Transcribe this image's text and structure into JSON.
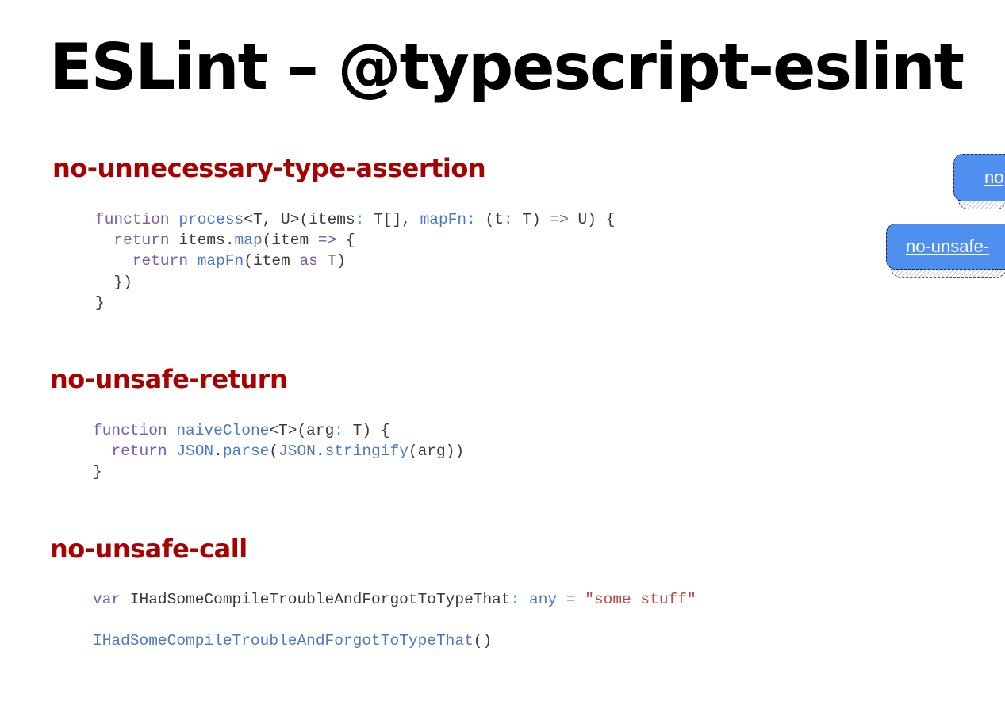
{
  "slide": {
    "title": "ESLint – @typescript-eslint"
  },
  "sections": [
    {
      "heading": "no-unnecessary-type-assertion",
      "code_lines": [
        "function process<T, U>(items: T[], mapFn: (t: T) => U) {",
        "  return items.map(item => {",
        "    return mapFn(item as T)",
        "  })",
        "}"
      ]
    },
    {
      "heading": "no-unsafe-return",
      "code_lines": [
        "function naiveClone<T>(arg: T) {",
        "  return JSON.parse(JSON.stringify(arg))",
        "}"
      ]
    },
    {
      "heading": "no-unsafe-call",
      "code_lines": [
        "var IHadSomeCompileTroubleAndForgotToTypeThat: any = \"some stuff\"",
        "",
        "IHadSomeCompileTroubleAndForgotToTypeThat()"
      ]
    }
  ],
  "side_links": [
    {
      "label": "no"
    },
    {
      "label": "no-unsafe-"
    }
  ],
  "colors": {
    "heading": "#a90000",
    "link_bg": "#4f8ff0",
    "keyword": "#7b5aa6",
    "function": "#4a7ac7",
    "string": "#b84a4a"
  }
}
